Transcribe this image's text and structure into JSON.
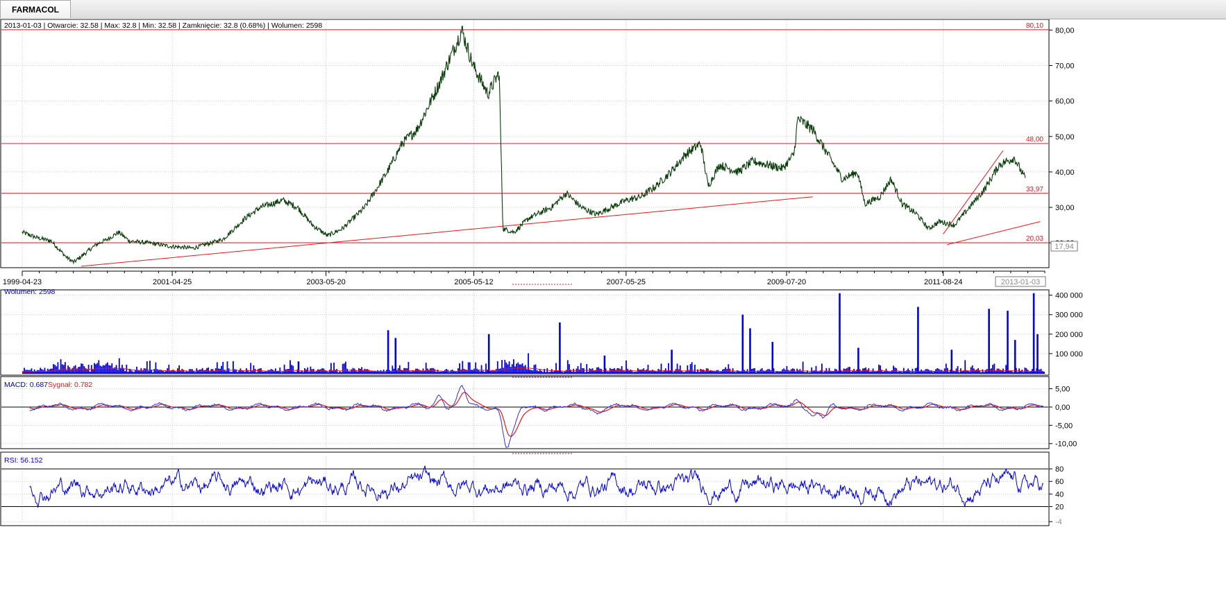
{
  "tab": {
    "label": "FARMACOL"
  },
  "info_line": "2013-01-03 | Otwarcie: 32.58 | Max: 32.8 | Min: 32.58 | Zamknięcie: 32.8 (0.68%)  | Wolumen: 2598",
  "colors": {
    "price": "#0b3d0b",
    "price_accent": "#1a8a1a",
    "lines": "#e8141c",
    "volume": "#0000e0",
    "volume_ma": "#e8141c",
    "macd": "#3030e0",
    "signal": "#e8141c",
    "rsi": "#0000e0",
    "grid": "#c8c8c8",
    "label_text": "#0000c8"
  },
  "chart_data": [
    {
      "type": "line",
      "name": "price",
      "ylim": [
        13,
        83
      ],
      "y_ticks": [
        "20,00",
        "30,00",
        "40,00",
        "50,00",
        "60,00",
        "70,00",
        "80,00"
      ],
      "y_tick_values": [
        20,
        30,
        40,
        50,
        60,
        70,
        80
      ],
      "x_ticks": [
        "1999-04-23",
        "2001-04-25",
        "2003-05-20",
        "2005-05-12",
        "2007-05-25",
        "2009-07-20",
        "2011-08-24"
      ],
      "x_tick_years": [
        1999.31,
        2001.32,
        2003.38,
        2005.36,
        2007.4,
        2009.55,
        2011.65
      ],
      "x_range": [
        1999.31,
        2013.01
      ],
      "current_date_label": "2013-01-03",
      "current_price_label": "17,94",
      "points": [
        [
          1999.31,
          23
        ],
        [
          1999.5,
          21.5
        ],
        [
          1999.7,
          20.5
        ],
        [
          1999.9,
          16
        ],
        [
          2000.0,
          14.5
        ],
        [
          2000.15,
          17
        ],
        [
          2000.3,
          19.5
        ],
        [
          2000.45,
          21
        ],
        [
          2000.6,
          23
        ],
        [
          2000.75,
          20.5
        ],
        [
          2001.0,
          20
        ],
        [
          2001.3,
          19
        ],
        [
          2001.6,
          18.5
        ],
        [
          2002.0,
          21
        ],
        [
          2002.3,
          27
        ],
        [
          2002.5,
          30
        ],
        [
          2002.8,
          32
        ],
        [
          2003.0,
          30
        ],
        [
          2003.2,
          25
        ],
        [
          2003.4,
          22
        ],
        [
          2003.6,
          24
        ],
        [
          2003.9,
          30
        ],
        [
          2004.2,
          40
        ],
        [
          2004.4,
          48
        ],
        [
          2004.6,
          52
        ],
        [
          2004.9,
          65
        ],
        [
          2005.1,
          75
        ],
        [
          2005.2,
          80
        ],
        [
          2005.35,
          70
        ],
        [
          2005.55,
          62
        ],
        [
          2005.7,
          68
        ],
        [
          2005.75,
          24
        ],
        [
          2005.9,
          23
        ],
        [
          2006.1,
          27
        ],
        [
          2006.4,
          30
        ],
        [
          2006.6,
          34
        ],
        [
          2006.8,
          30
        ],
        [
          2007.0,
          28
        ],
        [
          2007.2,
          30
        ],
        [
          2007.4,
          32
        ],
        [
          2007.6,
          33
        ],
        [
          2007.8,
          36
        ],
        [
          2008.0,
          40
        ],
        [
          2008.2,
          45
        ],
        [
          2008.4,
          48
        ],
        [
          2008.5,
          36
        ],
        [
          2008.65,
          42
        ],
        [
          2008.9,
          40
        ],
        [
          2009.1,
          43
        ],
        [
          2009.3,
          42
        ],
        [
          2009.5,
          41
        ],
        [
          2009.65,
          45
        ],
        [
          2009.7,
          55
        ],
        [
          2009.9,
          52
        ],
        [
          2010.1,
          45
        ],
        [
          2010.3,
          38
        ],
        [
          2010.5,
          40
        ],
        [
          2010.6,
          31
        ],
        [
          2010.8,
          33
        ],
        [
          2010.95,
          38
        ],
        [
          2011.1,
          31
        ],
        [
          2011.3,
          28
        ],
        [
          2011.45,
          24
        ],
        [
          2011.6,
          26
        ],
        [
          2011.8,
          25
        ],
        [
          2012.0,
          30
        ],
        [
          2012.2,
          35
        ],
        [
          2012.4,
          42
        ],
        [
          2012.6,
          44
        ],
        [
          2012.75,
          38
        ]
      ],
      "horizontal_lines": [
        {
          "value": 80.1,
          "label": "80,10"
        },
        {
          "value": 48.0,
          "label": "48,00"
        },
        {
          "value": 33.97,
          "label": "33,97"
        },
        {
          "value": 20.03,
          "label": "20,03"
        }
      ]
    },
    {
      "type": "bar",
      "name": "volume",
      "title": "Wolumen: 2598",
      "ylim": [
        0,
        420000
      ],
      "y_ticks": [
        "100 000",
        "200 000",
        "300 000",
        "400 000"
      ],
      "y_tick_values": [
        100000,
        200000,
        300000,
        400000
      ],
      "spikes": [
        [
          2003.0,
          60000
        ],
        [
          2004.2,
          220000
        ],
        [
          2004.3,
          180000
        ],
        [
          2005.55,
          200000
        ],
        [
          2006.5,
          260000
        ],
        [
          2007.1,
          90000
        ],
        [
          2008.0,
          120000
        ],
        [
          2008.95,
          300000
        ],
        [
          2009.05,
          230000
        ],
        [
          2009.35,
          160000
        ],
        [
          2010.25,
          410000
        ],
        [
          2010.5,
          130000
        ],
        [
          2011.3,
          340000
        ],
        [
          2011.75,
          120000
        ],
        [
          2012.25,
          330000
        ],
        [
          2012.5,
          320000
        ],
        [
          2012.6,
          170000
        ],
        [
          2012.85,
          410000
        ],
        [
          2012.9,
          200000
        ]
      ]
    },
    {
      "type": "line",
      "name": "macd",
      "title_macd": "MACD: 0.687",
      "title_signal": "Sygnał: 0.782",
      "ylim": [
        -11,
        7
      ],
      "y_ticks": [
        "5,00",
        "0,00",
        "-5,00",
        "-10,00"
      ],
      "y_tick_values": [
        5,
        0,
        -5,
        -10
      ]
    },
    {
      "type": "line",
      "name": "rsi",
      "title": "RSI: 56.152",
      "ylim": [
        -6,
        100
      ],
      "y_ticks": [
        "20",
        "40",
        "60",
        "80",
        "-4"
      ],
      "y_tick_values": [
        20,
        40,
        60,
        80,
        -4
      ],
      "bands": [
        80,
        20
      ]
    }
  ]
}
